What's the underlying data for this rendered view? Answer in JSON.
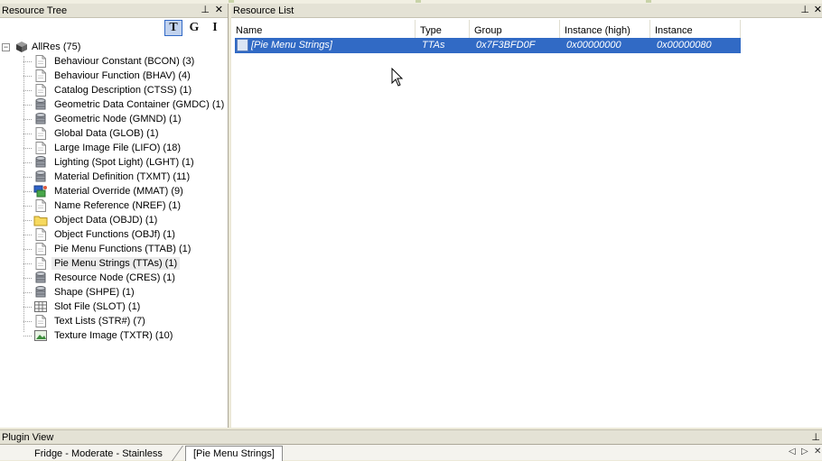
{
  "resource_tree": {
    "title": "Resource Tree",
    "pin": "⊥",
    "close": "✕",
    "toolbar": {
      "t": "T",
      "g": "G",
      "i": "I"
    },
    "root": "AllRes (75)",
    "items": [
      {
        "label": "Behaviour Constant (BCON) (3)",
        "icon": "document-icon"
      },
      {
        "label": "Behaviour Function (BHAV) (4)",
        "icon": "document-icon"
      },
      {
        "label": "Catalog Description (CTSS) (1)",
        "icon": "document-icon"
      },
      {
        "label": "Geometric Data Container (GMDC) (1)",
        "icon": "database-icon"
      },
      {
        "label": "Geometric Node (GMND) (1)",
        "icon": "database-icon"
      },
      {
        "label": "Global Data (GLOB) (1)",
        "icon": "document-icon"
      },
      {
        "label": "Large Image File (LIFO) (18)",
        "icon": "document-icon"
      },
      {
        "label": "Lighting (Spot Light) (LGHT) (1)",
        "icon": "database-icon"
      },
      {
        "label": "Material Definition (TXMT) (11)",
        "icon": "database-icon"
      },
      {
        "label": "Material Override (MMAT) (9)",
        "icon": "material-override-icon"
      },
      {
        "label": "Name Reference (NREF) (1)",
        "icon": "document-icon"
      },
      {
        "label": "Object Data (OBJD) (1)",
        "icon": "folder-icon"
      },
      {
        "label": "Object Functions (OBJf) (1)",
        "icon": "document-icon"
      },
      {
        "label": "Pie Menu Functions (TTAB) (1)",
        "icon": "document-icon"
      },
      {
        "label": "Pie Menu Strings (TTAs) (1)",
        "icon": "document-icon"
      },
      {
        "label": "Resource Node (CRES) (1)",
        "icon": "database-icon"
      },
      {
        "label": "Shape (SHPE) (1)",
        "icon": "database-icon"
      },
      {
        "label": "Slot File (SLOT) (1)",
        "icon": "grid-icon"
      },
      {
        "label": "Text Lists (STR#) (7)",
        "icon": "document-icon"
      },
      {
        "label": "Texture Image (TXTR) (10)",
        "icon": "image-icon"
      }
    ],
    "selected_index": 14
  },
  "resource_list": {
    "title": "Resource List",
    "pin": "⊥",
    "close": "✕",
    "columns": [
      "Name",
      "Type",
      "Group",
      "Instance (high)",
      "Instance"
    ],
    "rows": [
      {
        "name": "[Pie Menu Strings]",
        "type": "TTAs",
        "group": "0x7F3BFD0F",
        "instance_high": "0x00000000",
        "instance": "0x00000080"
      }
    ]
  },
  "plugin_view": {
    "title": "Plugin View",
    "pin": "⊥",
    "tabs": [
      "Fridge - Moderate - Stainless",
      "[Pie Menu Strings]"
    ],
    "active_tab": 1,
    "nav_prev": "◁",
    "nav_next": "▷",
    "close": "✕"
  },
  "colors": {
    "selection": "#316ac5",
    "panel_header": "#e4e2d5",
    "background": "#ece9d8"
  }
}
